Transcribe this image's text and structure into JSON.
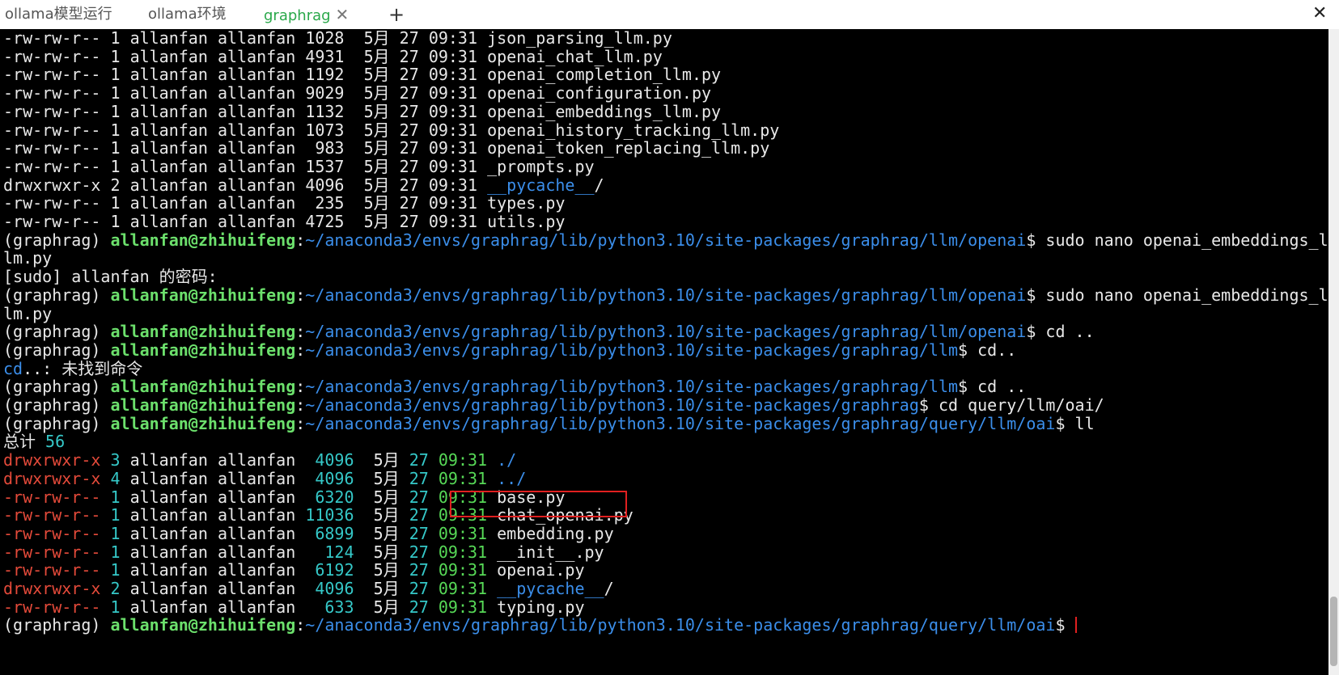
{
  "tabs": [
    {
      "label": "ollama模型运行"
    },
    {
      "label": "ollama环境"
    },
    {
      "label": "graphrag",
      "active": true,
      "close": "✕"
    }
  ],
  "new_tab_label": "+",
  "close_window_label": "✕",
  "prompt": {
    "env": "(graphrag) ",
    "user": "allanfan@zhihuifeng",
    "colon": ":",
    "path_openai_a": "~/anaconda3/envs/graphrag/lib/python3.10/site-packages/graphrag/llm/openai",
    "path_openai": "~/anaconda3/envs/graphrag/lib/python3.10/site-packages/graphrag/llm/openai",
    "path_llm": "~/anaconda3/envs/graphrag/lib/python3.10/site-packages/graphrag/llm",
    "path_graphrag": "~/anaconda3/envs/graphrag/lib/python3.10/site-packages/graphrag",
    "path_oai": "~/anaconda3/envs/graphrag/lib/python3.10/site-packages/graphrag/query/llm/oai",
    "dollar": "$"
  },
  "top_listing": [
    {
      "perm": "-rw-rw-r--",
      "links": "1",
      "user": "allanfan",
      "group": "allanfan",
      "size": "1028",
      "month": "5月",
      "day": "27",
      "time": "09:31",
      "name": "json_parsing_llm.py"
    },
    {
      "perm": "-rw-rw-r--",
      "links": "1",
      "user": "allanfan",
      "group": "allanfan",
      "size": "4931",
      "month": "5月",
      "day": "27",
      "time": "09:31",
      "name": "openai_chat_llm.py"
    },
    {
      "perm": "-rw-rw-r--",
      "links": "1",
      "user": "allanfan",
      "group": "allanfan",
      "size": "1192",
      "month": "5月",
      "day": "27",
      "time": "09:31",
      "name": "openai_completion_llm.py"
    },
    {
      "perm": "-rw-rw-r--",
      "links": "1",
      "user": "allanfan",
      "group": "allanfan",
      "size": "9029",
      "month": "5月",
      "day": "27",
      "time": "09:31",
      "name": "openai_configuration.py"
    },
    {
      "perm": "-rw-rw-r--",
      "links": "1",
      "user": "allanfan",
      "group": "allanfan",
      "size": "1132",
      "month": "5月",
      "day": "27",
      "time": "09:31",
      "name": "openai_embeddings_llm.py"
    },
    {
      "perm": "-rw-rw-r--",
      "links": "1",
      "user": "allanfan",
      "group": "allanfan",
      "size": "1073",
      "month": "5月",
      "day": "27",
      "time": "09:31",
      "name": "openai_history_tracking_llm.py"
    },
    {
      "perm": "-rw-rw-r--",
      "links": "1",
      "user": "allanfan",
      "group": "allanfan",
      "size": " 983",
      "month": "5月",
      "day": "27",
      "time": "09:31",
      "name": "openai_token_replacing_llm.py"
    },
    {
      "perm": "-rw-rw-r--",
      "links": "1",
      "user": "allanfan",
      "group": "allanfan",
      "size": "1537",
      "month": "5月",
      "day": "27",
      "time": "09:31",
      "name": "_prompts.py"
    },
    {
      "perm": "drwxrwxr-x",
      "links": "2",
      "user": "allanfan",
      "group": "allanfan",
      "size": "4096",
      "month": "5月",
      "day": "27",
      "time": "09:31",
      "name": "__pycache__",
      "suffix": "/",
      "dir": true
    },
    {
      "perm": "-rw-rw-r--",
      "links": "1",
      "user": "allanfan",
      "group": "allanfan",
      "size": " 235",
      "month": "5月",
      "day": "27",
      "time": "09:31",
      "name": "types.py"
    },
    {
      "perm": "-rw-rw-r--",
      "links": "1",
      "user": "allanfan",
      "group": "allanfan",
      "size": "4725",
      "month": "5月",
      "day": "27",
      "time": "09:31",
      "name": "utils.py"
    }
  ],
  "cmd_nano_1": " sudo nano openai_embeddings_l",
  "cmd_nano_1_wrap": "lm.py",
  "sudo_prompt": "[sudo] allanfan 的密码:",
  "cmd_nano_2": " sudo nano openai_embeddings_l",
  "cmd_nano_2_wrap": "lm.py",
  "cmd_cd_dotdot_space": " cd ..",
  "cmd_cd_dotdot": " cd..",
  "err_cmd": "cd",
  "err_text": "..: 未找到命令",
  "cmd_cd_dotdot_space2": " cd ..",
  "cmd_cd_query": " cd query/llm/oai/",
  "cmd_ll": " ll",
  "total_label": "总计",
  "total_value": "56",
  "bottom_listing": [
    {
      "perm": "drwxrwxr-x",
      "links": "3",
      "user": "allanfan",
      "group": "allanfan",
      "size": " 4096",
      "month": "5月",
      "day": "27",
      "time": "09:31",
      "name": "./",
      "dir": true
    },
    {
      "perm": "drwxrwxr-x",
      "links": "4",
      "user": "allanfan",
      "group": "allanfan",
      "size": " 4096",
      "month": "5月",
      "day": "27",
      "time": "09:31",
      "name": "../",
      "dir": true
    },
    {
      "perm": "-rw-rw-r--",
      "links": "1",
      "user": "allanfan",
      "group": "allanfan",
      "size": " 6320",
      "month": "5月",
      "day": "27",
      "time": "09:31",
      "name": "base.py"
    },
    {
      "perm": "-rw-rw-r--",
      "links": "1",
      "user": "allanfan",
      "group": "allanfan",
      "size": "11036",
      "month": "5月",
      "day": "27",
      "time": "09:31",
      "name": "chat_openai.py"
    },
    {
      "perm": "-rw-rw-r--",
      "links": "1",
      "user": "allanfan",
      "group": "allanfan",
      "size": " 6899",
      "month": "5月",
      "day": "27",
      "time": "09:31",
      "name": "embedding.py",
      "highlighted": true
    },
    {
      "perm": "-rw-rw-r--",
      "links": "1",
      "user": "allanfan",
      "group": "allanfan",
      "size": "  124",
      "month": "5月",
      "day": "27",
      "time": "09:31",
      "name": "__init__.py"
    },
    {
      "perm": "-rw-rw-r--",
      "links": "1",
      "user": "allanfan",
      "group": "allanfan",
      "size": " 6192",
      "month": "5月",
      "day": "27",
      "time": "09:31",
      "name": "openai.py"
    },
    {
      "perm": "drwxrwxr-x",
      "links": "2",
      "user": "allanfan",
      "group": "allanfan",
      "size": " 4096",
      "month": "5月",
      "day": "27",
      "time": "09:31",
      "name": "__pycache__",
      "suffix": "/",
      "dir": true
    },
    {
      "perm": "-rw-rw-r--",
      "links": "1",
      "user": "allanfan",
      "group": "allanfan",
      "size": "  633",
      "month": "5月",
      "day": "27",
      "time": "09:31",
      "name": "typing.py"
    }
  ],
  "colors": {
    "background": "#000000",
    "prompt_user": "#6ce06c",
    "path": "#3b8eea",
    "perm_red": "#e44a3a",
    "size_cyan": "#35c8c8",
    "highlight_box": "#e02020",
    "active_tab": "#2aa84a"
  }
}
